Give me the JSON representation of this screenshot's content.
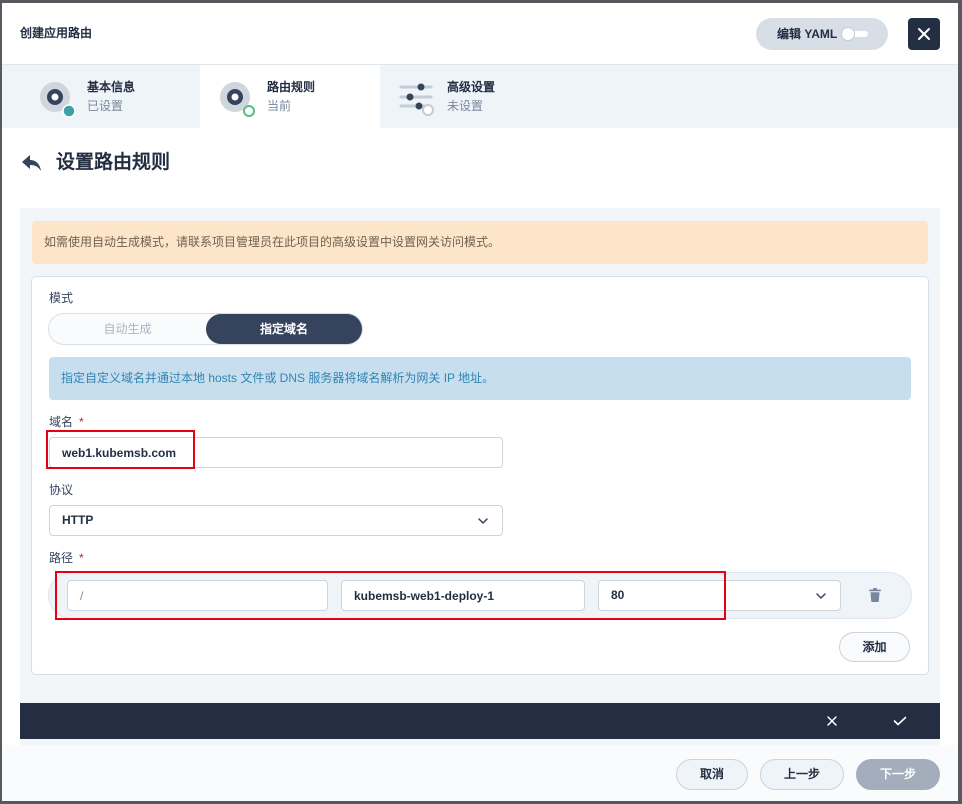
{
  "header": {
    "title": "创建应用路由",
    "yaml_label": "编辑 YAML",
    "yaml_toggle_on": false,
    "close_icon": "close-icon"
  },
  "steps": [
    {
      "title": "基本信息",
      "status": "已设置",
      "icon": "basic-info-icon"
    },
    {
      "title": "路由规则",
      "status": "当前",
      "icon": "route-rules-icon"
    },
    {
      "title": "高级设置",
      "status": "未设置",
      "icon": "advanced-settings-icon"
    }
  ],
  "active_step_index": 1,
  "page": {
    "title": "设置路由规则",
    "back_icon": "back-arrow-icon"
  },
  "warning": {
    "text": "如需使用自动生成模式，请联系项目管理员在此项目的高级设置中设置网关访问模式。"
  },
  "form": {
    "mode": {
      "label": "模式",
      "options": [
        "自动生成",
        "指定域名"
      ],
      "selected_index": 1
    },
    "info": "指定自定义域名并通过本地 hosts 文件或 DNS 服务器将域名解析为网关 IP 地址。",
    "required_mark": "*",
    "domain": {
      "label": "域名",
      "value": "web1.kubemsb.com"
    },
    "protocol": {
      "label": "协议",
      "value": "HTTP"
    },
    "paths": {
      "label": "路径",
      "rows": [
        {
          "path": "/",
          "service": "kubemsb-web1-deploy-1",
          "port": "80"
        }
      ],
      "add_label": "添加",
      "delete_icon": "trash-icon"
    }
  },
  "edit_bar": {
    "cancel_icon": "close-icon",
    "confirm_icon": "check-icon"
  },
  "footer": {
    "cancel": "取消",
    "prev": "上一步",
    "next": "下一步"
  },
  "colors": {
    "dark": "#242e42",
    "segment_active": "#36435c",
    "accent_green": "#55bc8a",
    "step_done": "#3fa0a5",
    "warning_bg": "#fde5c9",
    "warning_text": "#6f6151",
    "info_bg": "#c7deef",
    "info_text": "#3385b0",
    "required": "#ca2621",
    "annotation": "#e60012",
    "next_button": "#a3adbb"
  }
}
